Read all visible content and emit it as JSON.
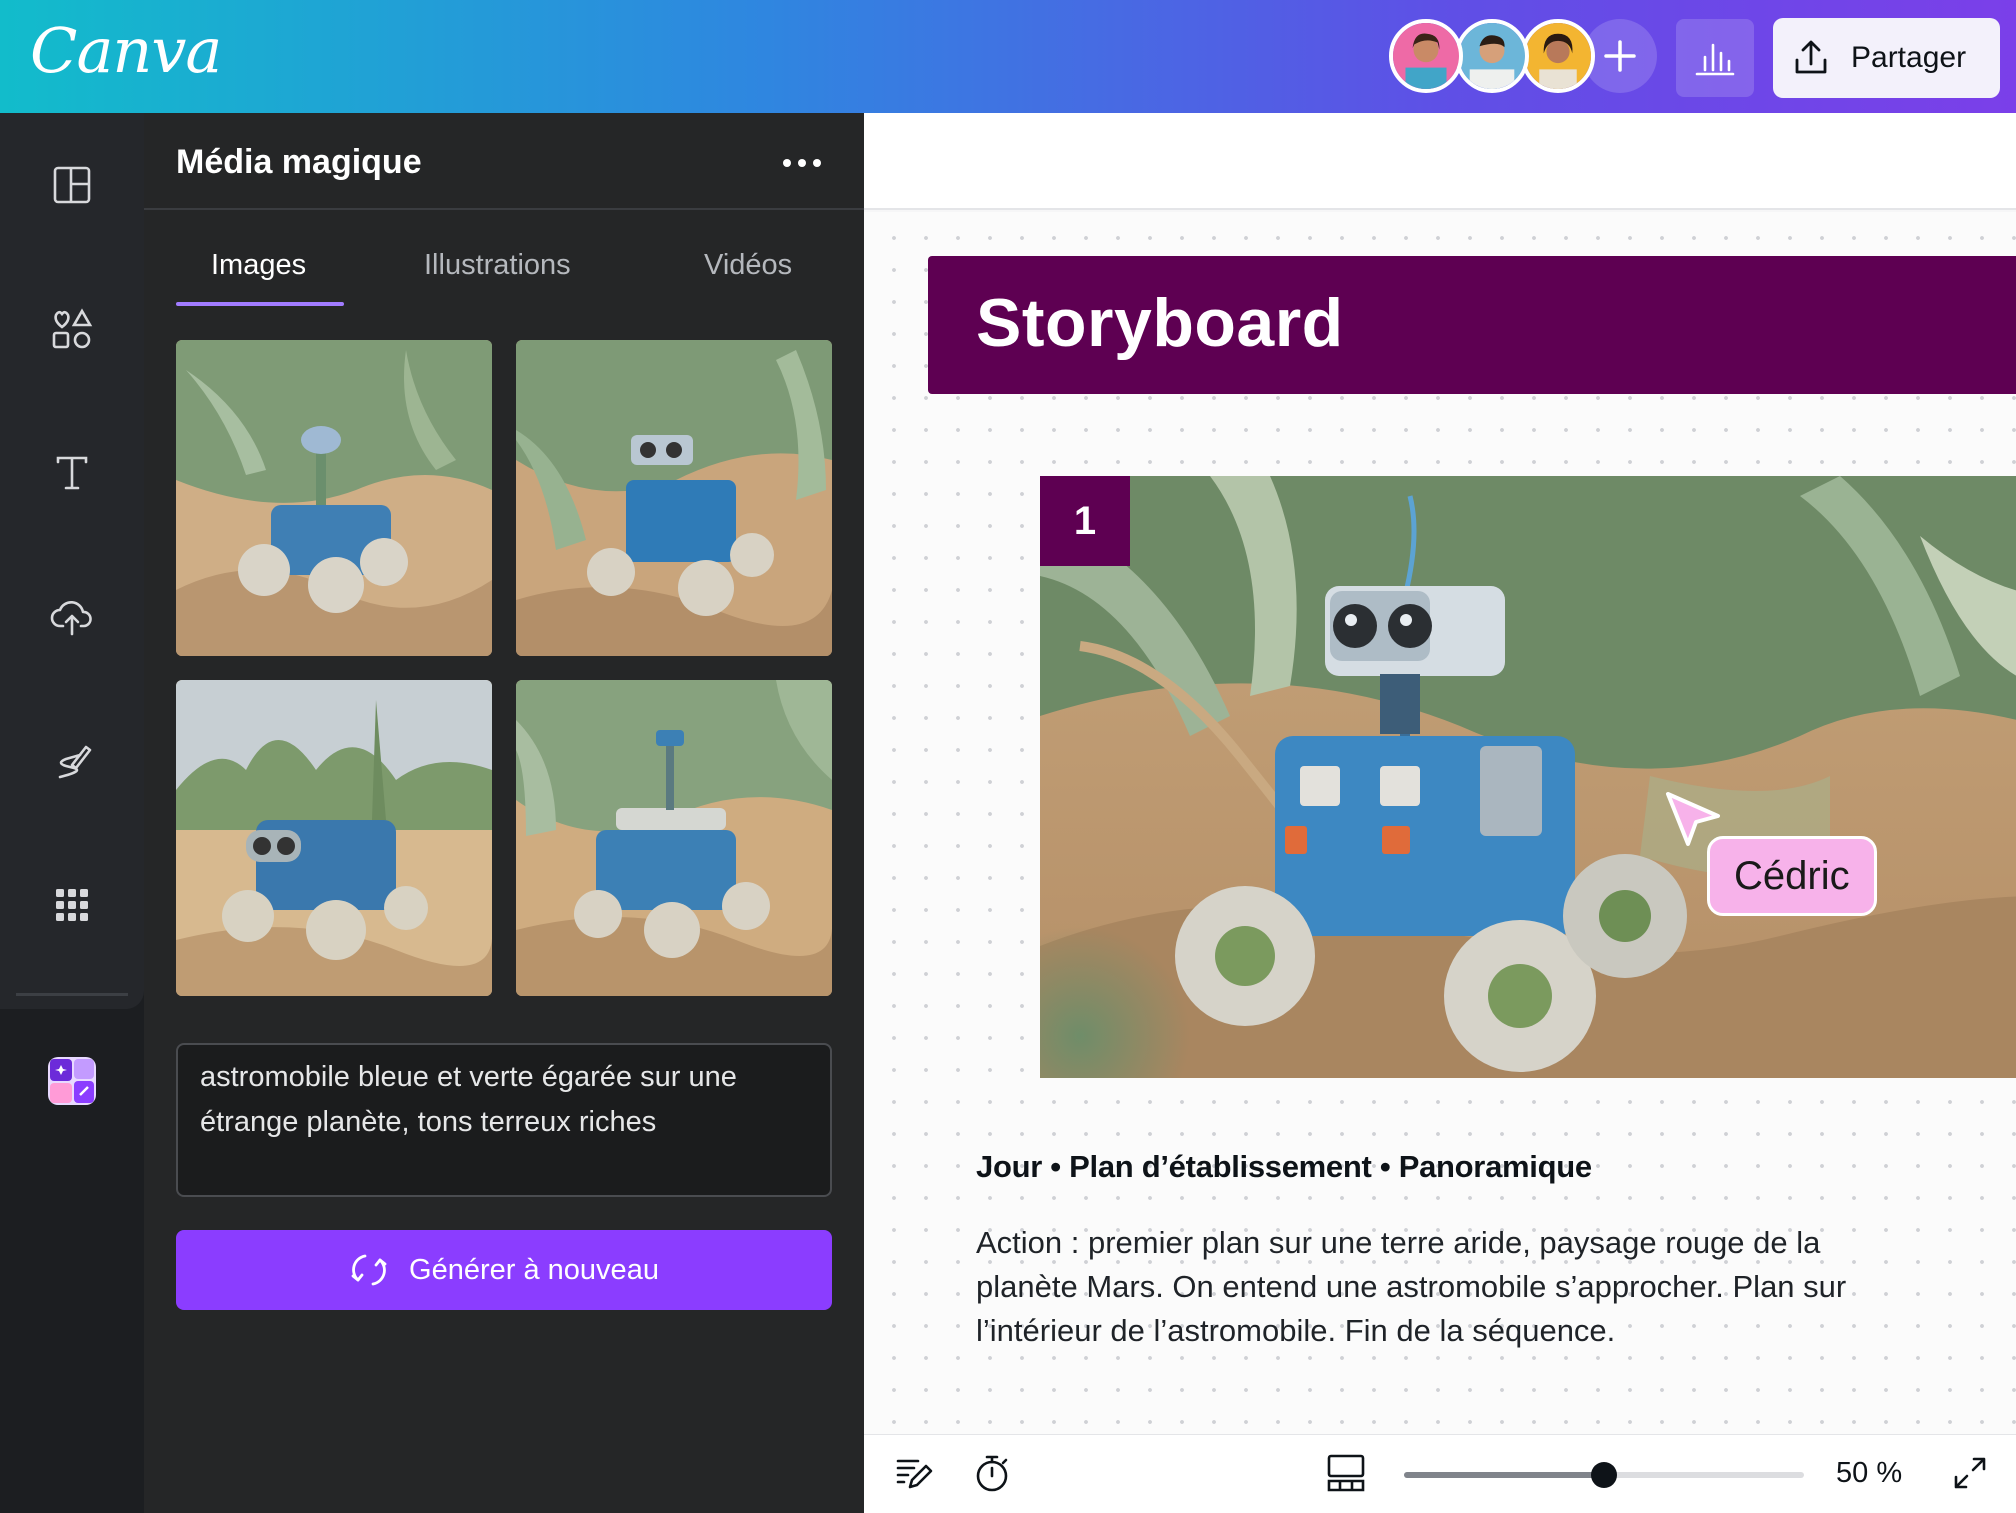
{
  "app": {
    "logo_text": "Canva",
    "share_label": "Partager",
    "colors": {
      "brand_purple": "#8b3dff",
      "title_banner": "#5e0052",
      "collab_cursor": "#f7b2ea"
    },
    "collaborators": [
      {
        "name": "collaborator-1",
        "bg": "#ee6aa6"
      },
      {
        "name": "collaborator-2",
        "bg": "#6cb6d9"
      },
      {
        "name": "collaborator-3",
        "bg": "#f3b531"
      }
    ]
  },
  "rail": {
    "items": [
      {
        "icon": "design-layout-icon"
      },
      {
        "icon": "elements-icon"
      },
      {
        "icon": "text-icon"
      },
      {
        "icon": "upload-cloud-icon"
      },
      {
        "icon": "draw-icon"
      },
      {
        "icon": "apps-grid-icon"
      },
      {
        "icon": "magic-media-app-icon"
      }
    ]
  },
  "panel": {
    "title": "Média magique",
    "tabs": [
      "Images",
      "Illustrations",
      "Vidéos"
    ],
    "active_tab": "Images",
    "prompt_text": "astromobile bleue et verte égarée sur une étrange planète, tons terreux riches",
    "regenerate_label": "Générer à nouveau"
  },
  "canvas": {
    "title": "Storyboard",
    "scene_number": "1",
    "collaborator_cursor_label": "Cédric",
    "scene_heading": "Jour • Plan d’établissement • Panoramique",
    "scene_description": "Action : premier plan sur une terre aride, paysage rouge de la planète Mars. On entend une astromobile s’approcher. Plan sur l’intérieur de l’astromobile. Fin de la séquence."
  },
  "bottombar": {
    "zoom_label": "50 %",
    "zoom_fraction": 0.5
  }
}
